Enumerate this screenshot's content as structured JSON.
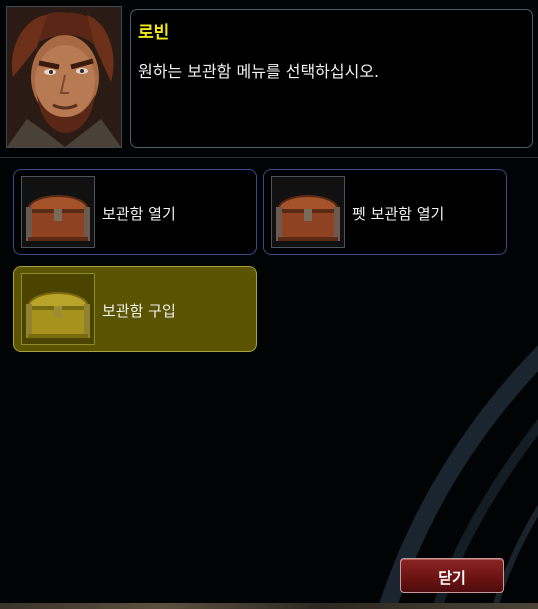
{
  "npc": {
    "name": "로빈",
    "message": "원하는 보관함 메뉴를 선택하십시오."
  },
  "options": [
    {
      "label": "보관함 열기",
      "icon": "chest-icon",
      "selected": false
    },
    {
      "label": "펫 보관함 열기",
      "icon": "chest-icon",
      "selected": false
    },
    {
      "label": "보관함 구입",
      "icon": "gold-chest-icon",
      "selected": true
    }
  ],
  "close_button": {
    "label": "닫기"
  },
  "colors": {
    "name": "#f3e51c",
    "selected_bg": "#5a5300",
    "option_border": "#3d4a8a",
    "close_button": "#7a1c1c"
  }
}
